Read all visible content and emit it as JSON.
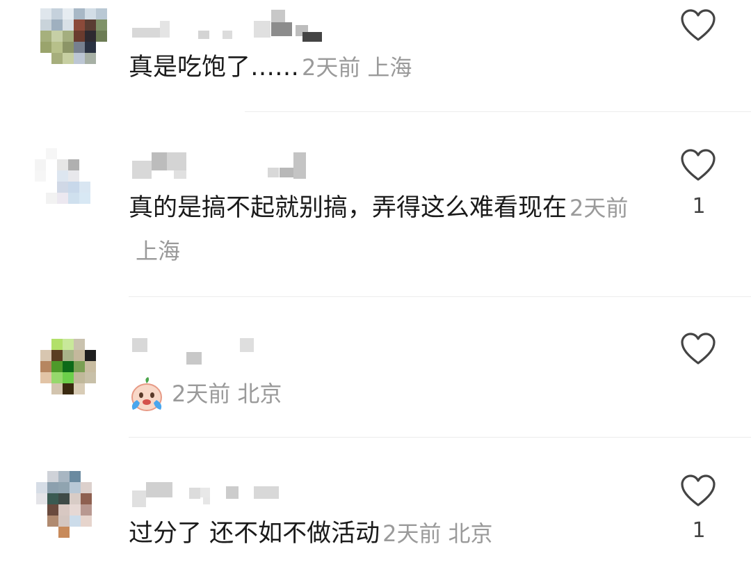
{
  "comments": [
    {
      "text": "真是吃饱了……",
      "time": "2天前",
      "location": "上海",
      "like_count": "",
      "like_icon": "heart-outline-icon"
    },
    {
      "text": "真的是搞不起就别搞，弄得这么难看现在",
      "time": "2天前",
      "location": "上海",
      "like_count": "1",
      "like_icon": "heart-outline-icon"
    },
    {
      "text": "",
      "emoji": "crying-face-emoji",
      "time": "2天前",
      "location": "北京",
      "like_count": "",
      "like_icon": "heart-outline-icon"
    },
    {
      "text": "过分了 还不如不做活动",
      "time": "2天前",
      "location": "北京",
      "like_count": "1",
      "like_icon": "heart-outline-icon"
    }
  ],
  "colors": {
    "text": "#1a1a1a",
    "meta": "#9a9a9a",
    "icon": "#444444",
    "divider": "#ececec"
  }
}
